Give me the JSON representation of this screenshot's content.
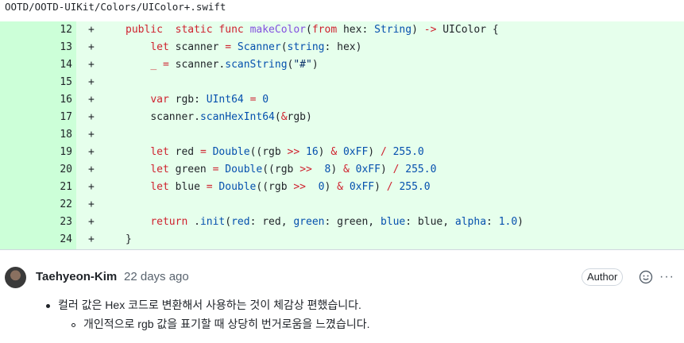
{
  "file": {
    "path": "OOTD/OOTD-UIKit/Colors/UIColor+.swift"
  },
  "diff": {
    "sign": "+",
    "lines": [
      {
        "num": "12",
        "indent": "",
        "tokens": [
          [
            "kw",
            "public"
          ],
          [
            "",
            "  "
          ],
          [
            "kw",
            "static"
          ],
          [
            "",
            " "
          ],
          [
            "kw",
            "func"
          ],
          [
            "",
            " "
          ],
          [
            "fn",
            "makeColor"
          ],
          [
            "",
            "("
          ],
          [
            "kw",
            "from"
          ],
          [
            "",
            " hex: "
          ],
          [
            "ty",
            "String"
          ],
          [
            "",
            ") "
          ],
          [
            "kw",
            "->"
          ],
          [
            "",
            " UIColor {"
          ]
        ]
      },
      {
        "num": "13",
        "indent": "    ",
        "tokens": [
          [
            "kw",
            "let"
          ],
          [
            "",
            " scanner "
          ],
          [
            "kw",
            "="
          ],
          [
            "",
            " "
          ],
          [
            "ty",
            "Scanner"
          ],
          [
            "",
            "("
          ],
          [
            "ty",
            "string"
          ],
          [
            "",
            ": hex)"
          ]
        ]
      },
      {
        "num": "14",
        "indent": "    ",
        "tokens": [
          [
            "kw",
            "_"
          ],
          [
            "",
            " "
          ],
          [
            "kw",
            "="
          ],
          [
            "",
            " scanner."
          ],
          [
            "ty",
            "scanString"
          ],
          [
            "",
            "("
          ],
          [
            "st",
            "\"#\""
          ],
          [
            "",
            ")"
          ]
        ]
      },
      {
        "num": "15",
        "indent": "",
        "tokens": []
      },
      {
        "num": "16",
        "indent": "    ",
        "tokens": [
          [
            "kw",
            "var"
          ],
          [
            "",
            " rgb: "
          ],
          [
            "ty",
            "UInt64"
          ],
          [
            "",
            " "
          ],
          [
            "kw",
            "="
          ],
          [
            "",
            " "
          ],
          [
            "nu",
            "0"
          ]
        ]
      },
      {
        "num": "17",
        "indent": "    ",
        "tokens": [
          [
            "",
            "scanner."
          ],
          [
            "ty",
            "scanHexInt64"
          ],
          [
            "",
            "("
          ],
          [
            "kw",
            "&"
          ],
          [
            "",
            "rgb)"
          ]
        ]
      },
      {
        "num": "18",
        "indent": "",
        "tokens": []
      },
      {
        "num": "19",
        "indent": "    ",
        "tokens": [
          [
            "kw",
            "let"
          ],
          [
            "",
            " red "
          ],
          [
            "kw",
            "="
          ],
          [
            "",
            " "
          ],
          [
            "ty",
            "Double"
          ],
          [
            "",
            "((rgb "
          ],
          [
            "kw",
            ">>"
          ],
          [
            "",
            " "
          ],
          [
            "nu",
            "16"
          ],
          [
            "",
            ") "
          ],
          [
            "kw",
            "&"
          ],
          [
            "",
            " "
          ],
          [
            "nu",
            "0xFF"
          ],
          [
            "",
            ") "
          ],
          [
            "kw",
            "/"
          ],
          [
            "",
            " "
          ],
          [
            "nu",
            "255.0"
          ]
        ]
      },
      {
        "num": "20",
        "indent": "    ",
        "tokens": [
          [
            "kw",
            "let"
          ],
          [
            "",
            " green "
          ],
          [
            "kw",
            "="
          ],
          [
            "",
            " "
          ],
          [
            "ty",
            "Double"
          ],
          [
            "",
            "((rgb "
          ],
          [
            "kw",
            ">>"
          ],
          [
            "",
            "  "
          ],
          [
            "nu",
            "8"
          ],
          [
            "",
            ") "
          ],
          [
            "kw",
            "&"
          ],
          [
            "",
            " "
          ],
          [
            "nu",
            "0xFF"
          ],
          [
            "",
            ") "
          ],
          [
            "kw",
            "/"
          ],
          [
            "",
            " "
          ],
          [
            "nu",
            "255.0"
          ]
        ]
      },
      {
        "num": "21",
        "indent": "    ",
        "tokens": [
          [
            "kw",
            "let"
          ],
          [
            "",
            " blue "
          ],
          [
            "kw",
            "="
          ],
          [
            "",
            " "
          ],
          [
            "ty",
            "Double"
          ],
          [
            "",
            "((rgb "
          ],
          [
            "kw",
            ">>"
          ],
          [
            "",
            "  "
          ],
          [
            "nu",
            "0"
          ],
          [
            "",
            ") "
          ],
          [
            "kw",
            "&"
          ],
          [
            "",
            " "
          ],
          [
            "nu",
            "0xFF"
          ],
          [
            "",
            ") "
          ],
          [
            "kw",
            "/"
          ],
          [
            "",
            " "
          ],
          [
            "nu",
            "255.0"
          ]
        ]
      },
      {
        "num": "22",
        "indent": "",
        "tokens": []
      },
      {
        "num": "23",
        "indent": "    ",
        "tokens": [
          [
            "kw",
            "return"
          ],
          [
            "",
            " ."
          ],
          [
            "ty",
            "init"
          ],
          [
            "",
            "("
          ],
          [
            "ty",
            "red"
          ],
          [
            "",
            ": red, "
          ],
          [
            "ty",
            "green"
          ],
          [
            "",
            ": green, "
          ],
          [
            "ty",
            "blue"
          ],
          [
            "",
            ": blue, "
          ],
          [
            "ty",
            "alpha"
          ],
          [
            "",
            ": "
          ],
          [
            "nu",
            "1.0"
          ],
          [
            "",
            ")"
          ]
        ]
      },
      {
        "num": "24",
        "indent": "",
        "tokens": [
          [
            "",
            "}"
          ]
        ]
      }
    ]
  },
  "comment": {
    "author": "Taehyeon-Kim",
    "time": "22 days ago",
    "badge": "Author",
    "more": "···",
    "bullet1": "컬러 값은 Hex 코드로 변환해서 사용하는 것이 체감상 편했습니다.",
    "bullet2": "개인적으로 rgb 값을 표기할 때 상당히 번거로움을 느꼈습니다."
  },
  "colors": {
    "added_bg": "#e6ffec",
    "added_gutter": "#ccffd8",
    "keyword": "#cf222e",
    "type": "#0550ae",
    "function": "#8250df"
  }
}
